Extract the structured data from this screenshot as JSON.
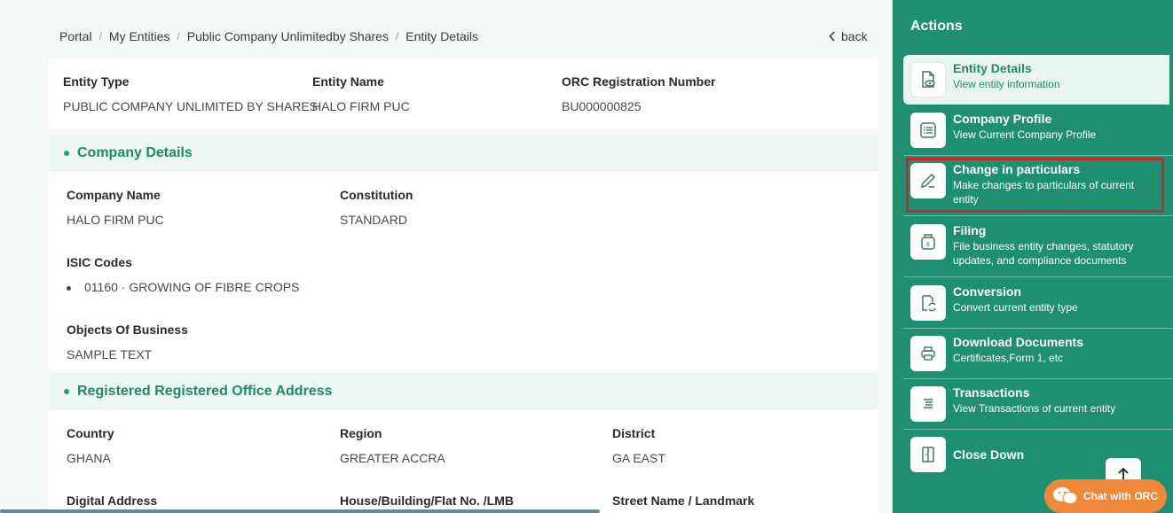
{
  "breadcrumb": {
    "items": [
      "Portal",
      "My Entities",
      "Public Company Unlimitedby Shares",
      "Entity Details"
    ],
    "separator": "/"
  },
  "back_label": "back",
  "entity": {
    "type_label": "Entity Type",
    "type_value": "PUBLIC COMPANY UNLIMITED BY SHARES",
    "name_label": "Entity Name",
    "name_value": "HALO FIRM PUC",
    "orc_label": "ORC Registration Number",
    "orc_value": "BU000000825"
  },
  "company_details": {
    "title": "Company Details",
    "company_name_label": "Company Name",
    "company_name_value": "HALO FIRM PUC",
    "constitution_label": "Constitution",
    "constitution_value": "STANDARD",
    "isic_label": "ISIC Codes",
    "isic_items": [
      "01160 · GROWING OF FIBRE CROPS"
    ],
    "objects_label": "Objects Of Business",
    "objects_value": "SAMPLE TEXT"
  },
  "address": {
    "title": "Registered Registered Office Address",
    "country_label": "Country",
    "country_value": "GHANA",
    "region_label": "Region",
    "region_value": "GREATER ACCRA",
    "district_label": "District",
    "district_value": "GA EAST",
    "digital_label": "Digital Address",
    "house_label": "House/Building/Flat No. /LMB",
    "street_label": "Street Name / Landmark"
  },
  "sidebar": {
    "heading": "Actions",
    "actions": [
      {
        "title": "Entity Details",
        "subtitle": "View entity information",
        "icon": "document-eye-icon"
      },
      {
        "title": "Company Profile",
        "subtitle": "View Current Company Profile",
        "icon": "list-icon"
      },
      {
        "title": "Change in particulars",
        "subtitle": "Make changes to particulars of current entity",
        "icon": "pencil-icon"
      },
      {
        "title": "Filing",
        "subtitle": "File business entity changes, statutory updates, and compliance documents",
        "icon": "money-bag-icon"
      },
      {
        "title": "Conversion",
        "subtitle": "Convert current entity type",
        "icon": "convert-icon"
      },
      {
        "title": "Download Documents",
        "subtitle": "Certificates,Form 1, etc",
        "icon": "printer-icon"
      },
      {
        "title": "Transactions",
        "subtitle": "View Transactions of current entity",
        "icon": "transactions-icon"
      },
      {
        "title": "Close Down",
        "subtitle": "",
        "icon": "door-icon"
      }
    ]
  },
  "chat_label": "Chat with ORC",
  "colors": {
    "accent": "#1f8f72",
    "highlight": "#d0262b",
    "chat": "#f0883a"
  }
}
